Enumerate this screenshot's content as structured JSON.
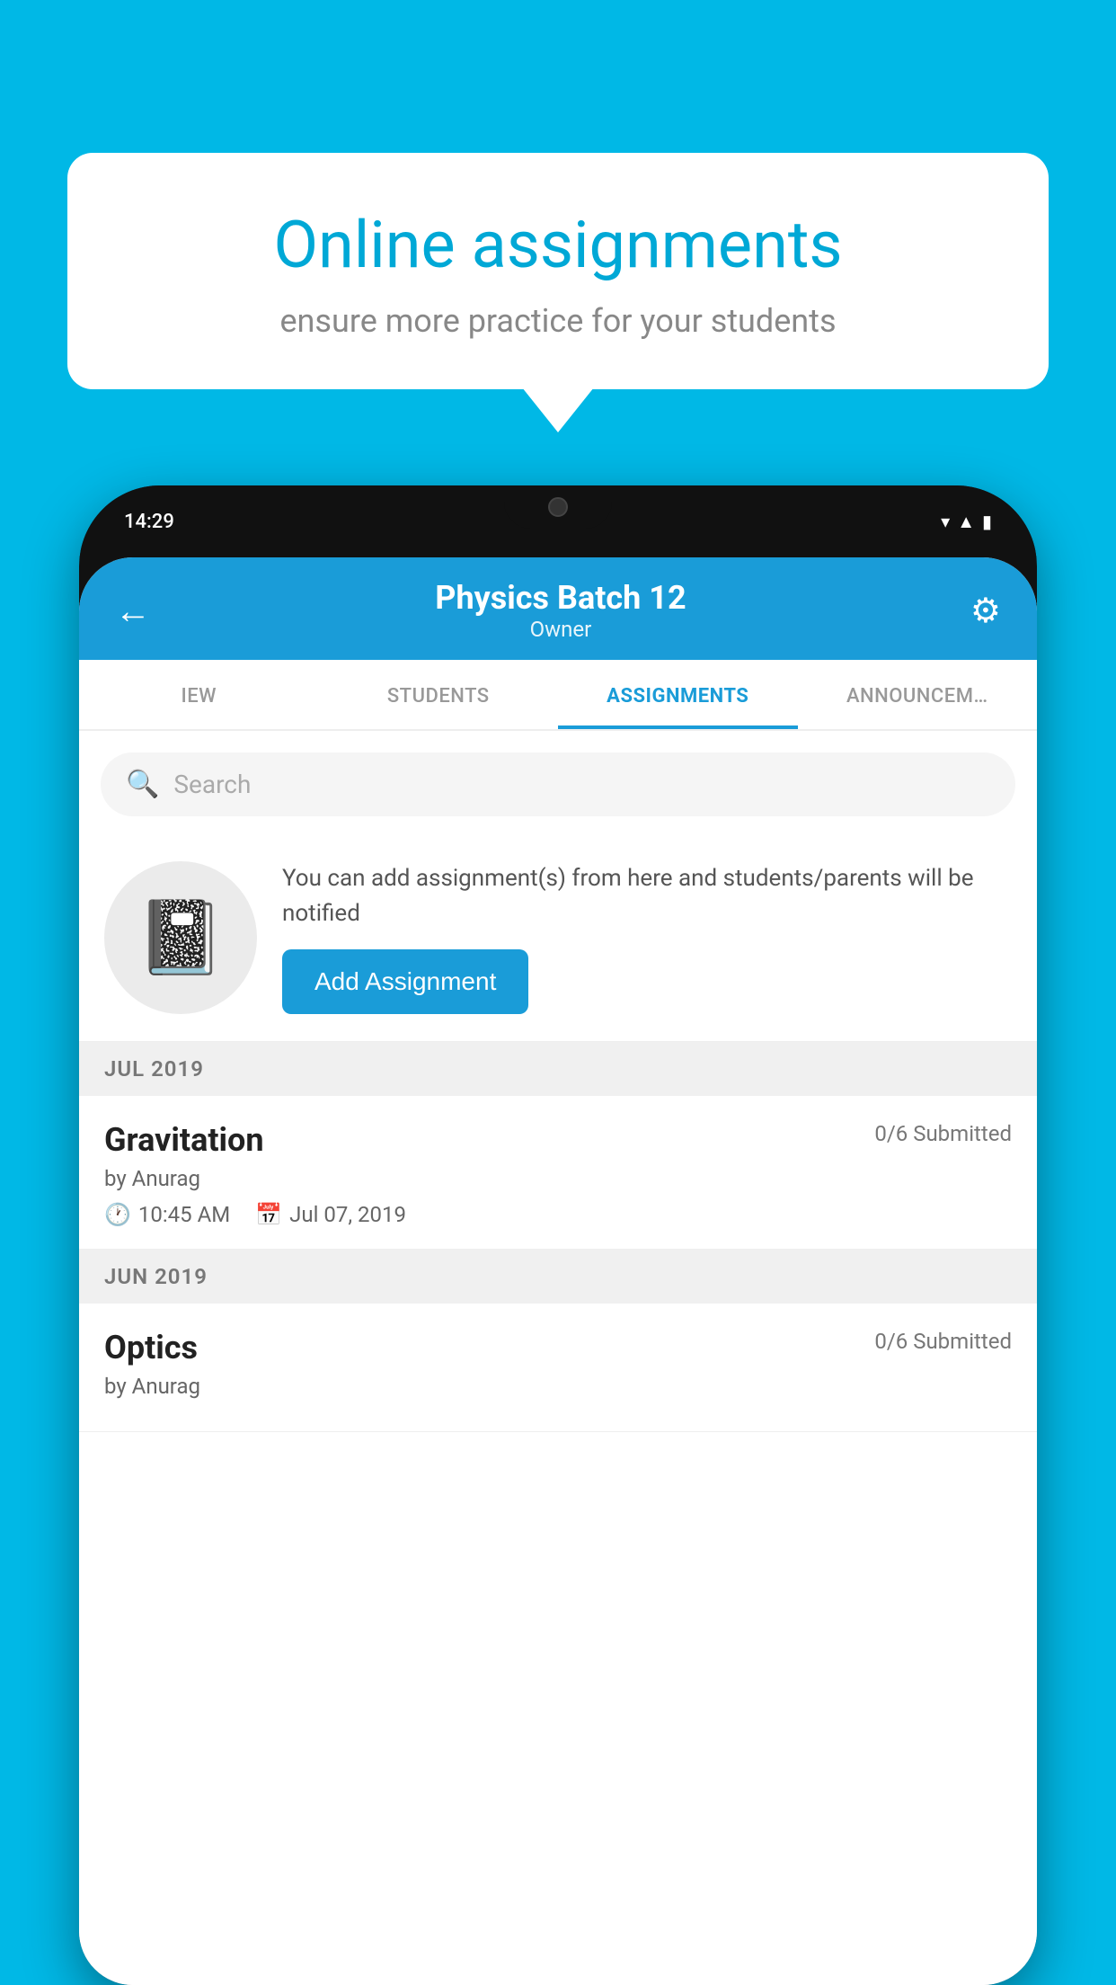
{
  "background_color": "#00b8e6",
  "bubble": {
    "title": "Online assignments",
    "subtitle": "ensure more practice for your students"
  },
  "phone": {
    "status_time": "14:29",
    "status_icons": [
      "wifi",
      "signal",
      "battery"
    ]
  },
  "header": {
    "title": "Physics Batch 12",
    "subtitle": "Owner",
    "back_label": "←",
    "gear_label": "⚙"
  },
  "tabs": [
    {
      "label": "IEW",
      "active": false
    },
    {
      "label": "STUDENTS",
      "active": false
    },
    {
      "label": "ASSIGNMENTS",
      "active": true
    },
    {
      "label": "ANNOUNCEM…",
      "active": false
    }
  ],
  "search": {
    "placeholder": "Search"
  },
  "promo": {
    "description": "You can add assignment(s) from here and students/parents will be notified",
    "button_label": "Add Assignment"
  },
  "sections": [
    {
      "label": "JUL 2019",
      "assignments": [
        {
          "name": "Gravitation",
          "submitted": "0/6 Submitted",
          "author": "by Anurag",
          "time": "10:45 AM",
          "date": "Jul 07, 2019"
        }
      ]
    },
    {
      "label": "JUN 2019",
      "assignments": [
        {
          "name": "Optics",
          "submitted": "0/6 Submitted",
          "author": "by Anurag",
          "time": "",
          "date": ""
        }
      ]
    }
  ]
}
